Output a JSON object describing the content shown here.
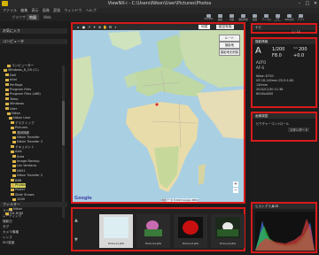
{
  "window": {
    "title": "ViewNX-i - C:\\Users\\Nikon\\User\\Pictures\\Photos",
    "minimize": "–",
    "maximize": "□",
    "close": "✕"
  },
  "menu": [
    "ファイル",
    "編集",
    "表示",
    "画像",
    "変換",
    "ウィンドウ",
    "ヘルプ"
  ],
  "tabs": [
    "ブラウザ",
    "地図",
    "Web"
  ],
  "toolbar": [
    "Transfer",
    "編集",
    "印刷",
    "動画作成",
    "変換",
    "アップロード",
    "NX Studio",
    "SNS共有",
    "アプリ"
  ],
  "left": {
    "favorites": "お気に入り",
    "computer": "コンピュータ",
    "tree": [
      "コンピューター",
      "Windows_8_OS (C:)",
      "Dell",
      "Intel",
      "Perflogs",
      "Program Files",
      "Program Files (x86)",
      "Temp",
      "Windows",
      "User",
      "Nikon",
      "Nikon User",
      "デスクトップ",
      "Pictures",
      "連続撮影",
      "Nikon Transfer",
      "Nikon Transfer 2",
      "ドキュメント",
      "AAA",
      "Area",
      "Image Backup",
      "Las Ventana",
      "NX01",
      "Nikon Transfer 2",
      "BBB",
      "Photos",
      "Poster",
      "Slide Shows",
      "1000",
      "Videos",
      "Nikon",
      "CD-ROM"
    ],
    "selected_index": 25,
    "filter_header": "フィルター",
    "keywords": [
      "ラベル",
      "レーティング",
      "撮影日",
      "タグ",
      "カメラ機種",
      "レンズ",
      "ISO感度"
    ]
  },
  "map": {
    "map_type": "地図",
    "satellite": "航空写真",
    "buttons": [
      "ルート",
      "撮影地",
      "撮影地を削除"
    ],
    "zoom_in": "+",
    "zoom_out": "−",
    "google": "Google",
    "attribution": "地図データ ©2015 Google, INEGI"
  },
  "filmstrip": [
    {
      "caption": "Picture1.JPG",
      "color": "#ddeef2"
    },
    {
      "caption": "Picture2.JPG",
      "color": "#3a7a3a"
    },
    {
      "caption": "Picture3.JPG",
      "color": "#c81010"
    },
    {
      "caption": "Picture4.JPG",
      "color": "#2a5a28"
    }
  ],
  "right": {
    "nav_header": "ナビ",
    "nav_counter": "1 / 15",
    "info_header": "撮影情報",
    "mode": "A",
    "shutter": "1/200",
    "aperture": "F8.0",
    "iso_label": "ISO",
    "iso": "200",
    "exposure": "+0.0",
    "wb": "AUTO",
    "focus": "AF-S",
    "camera": "Nikon D750",
    "lens": "VR 18-140mm f/3.5-5.6G",
    "focal": "140mm",
    "datetime": "2014/11/30 11:38",
    "size": "6016x4000",
    "adjust_header": "画像調整",
    "adjust_item": "ピクチャーコントロール",
    "adjust_value": "スタンダード",
    "histogram_header": "ヒストグラム",
    "histogram_mode": "RGB"
  }
}
